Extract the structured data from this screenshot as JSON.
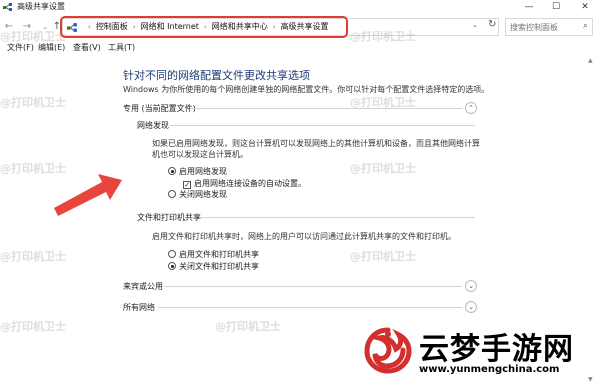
{
  "window": {
    "title": "高级共享设置",
    "controls": {
      "minimize": "—",
      "maximize": "☐",
      "close": "✕"
    }
  },
  "nav": {
    "back": "←",
    "forward": "→",
    "recent": "⌄",
    "up": "↑",
    "breadcrumbs": [
      "控制面板",
      "网络和 Internet",
      "网络和共享中心",
      "高级共享设置"
    ],
    "breadcrumb_separator": "›",
    "dropdown": "⌄",
    "refresh": "↻",
    "search_placeholder": "搜索控制面板",
    "search_icon": "⌕"
  },
  "menu": [
    "文件(F)",
    "编辑(E)",
    "查看(V)",
    "工具(T)"
  ],
  "page": {
    "title": "针对不同的网络配置文件更改共享选项",
    "description": "Windows 为你所使用的每个网络创建单独的网络配置文件。你可以针对每个配置文件选择特定的选项。"
  },
  "private_profile": {
    "heading": "专用 (当前配置文件)",
    "network_discovery": {
      "heading": "网络发现",
      "description": "如果已启用网络发现，则这台计算机可以发现网络上的其他计算机和设备，而且其他网络计算机也可以发现这台计算机。",
      "options": [
        {
          "label": "启用网络发现",
          "selected": true
        },
        {
          "label": "启用网络连接设备的自动设置。",
          "checked": true
        },
        {
          "label": "关闭网络发现",
          "selected": false
        }
      ]
    },
    "file_printer_sharing": {
      "heading": "文件和打印机共享",
      "description": "启用文件和打印机共享时，网络上的用户可以访问通过此计算机共享的文件和打印机。",
      "options": [
        {
          "label": "启用文件和打印机共享",
          "selected": false
        },
        {
          "label": "关闭文件和打印机共享",
          "selected": true
        }
      ]
    }
  },
  "guest_profile": {
    "heading": "来宾或公用"
  },
  "all_networks": {
    "heading": "所有网络"
  },
  "expander_icons": {
    "collapse": "⌃",
    "expand": "⌄"
  },
  "watermark_text": "@打印机卫士",
  "brand": {
    "name": "云梦手游网",
    "url": "www.yunmengchina.com"
  },
  "colors": {
    "highlight": "#e53935",
    "title_blue": "#1e3c78",
    "arrow": "#e8453c",
    "brand_red": "#d32f2f"
  }
}
